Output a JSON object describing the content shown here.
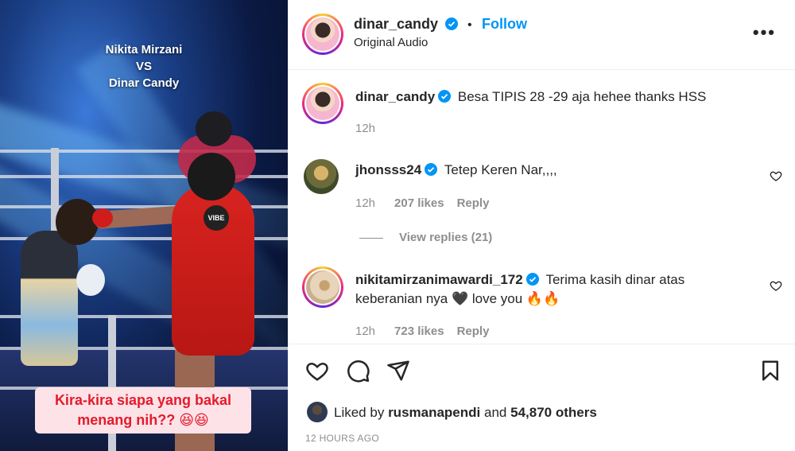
{
  "media": {
    "caption_top_line1": "Nikita Mirzani",
    "caption_top_line2": "VS",
    "caption_top_line3": "Dinar Candy",
    "caption_bottom": "Kira-kira siapa yang bakal menang nih?? 😆😆",
    "badge": "VIBE"
  },
  "header": {
    "username": "dinar_candy",
    "dot": "•",
    "follow_label": "Follow",
    "audio": "Original Audio",
    "more_label": "•••"
  },
  "caption": {
    "username": "dinar_candy",
    "text": "Besa TIPIS 28 -29 aja hehee thanks HSS",
    "time": "12h"
  },
  "comments": [
    {
      "username": "jhonsss24",
      "text": "Tetep Keren Nar,,,,",
      "time": "12h",
      "likes": "207 likes",
      "reply": "Reply"
    },
    {
      "username": "nikitamirzanimawardi_172",
      "text_line1": "Terima kasih dinar atas",
      "text_line2": "keberanian nya 🖤 love you 🔥🔥",
      "time": "12h",
      "likes": "723 likes",
      "reply": "Reply"
    }
  ],
  "view_replies": "View replies (21)",
  "likes_bar": {
    "prefix": "Liked by",
    "user": "rusmanapendi",
    "middle": "and",
    "count": "54,870 others"
  },
  "post_time": "12 HOURS AGO",
  "colors": {
    "accent": "#0095f6",
    "verified": "#0095f6",
    "muted": "#8e8e8e",
    "caption_red": "#e51a2c"
  }
}
